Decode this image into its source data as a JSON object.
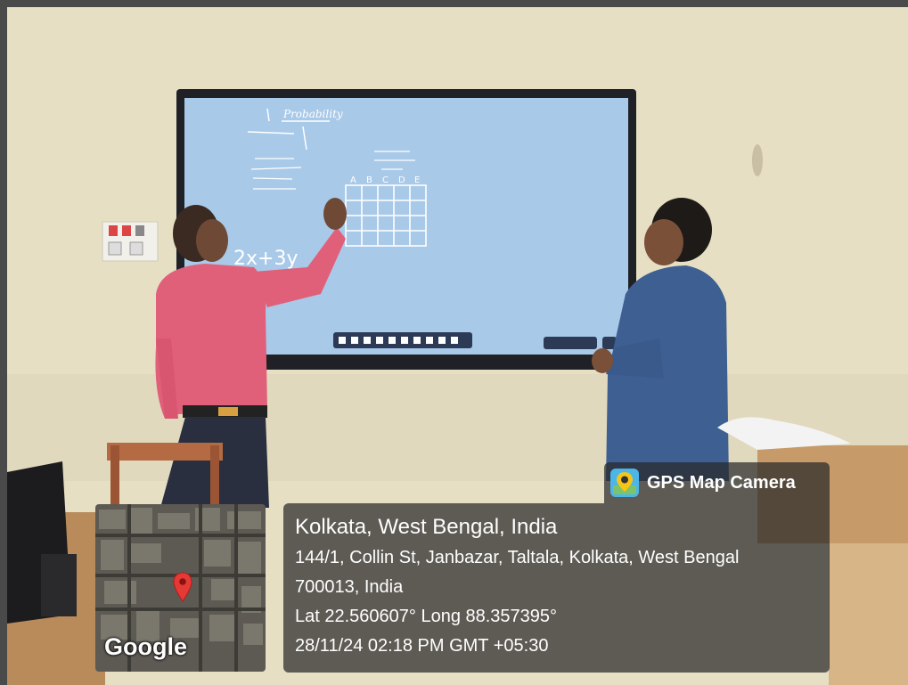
{
  "gps_badge": {
    "app_name": "GPS Map Camera",
    "icon": "map-pin-camera-icon"
  },
  "map": {
    "provider_label": "Google",
    "pin_color": "#e53935"
  },
  "location": {
    "title": "Kolkata, West Bengal, India",
    "address_line_1": "144/1, Collin St, Janbazar, Taltala, Kolkata, West Bengal",
    "address_line_2": "700013, India",
    "coordinates": "Lat 22.560607° Long 88.357395°",
    "datetime": "28/11/24 02:18 PM GMT +05:30"
  },
  "board": {
    "heading": "Probability",
    "equation": "2x+3y",
    "grid_columns": [
      "A",
      "B",
      "C",
      "D",
      "E"
    ]
  },
  "colors": {
    "wall": "#e8e1c6",
    "board_screen": "#a8c8e6",
    "shirt_pink": "#e0607a",
    "shirt_blue": "#3a5a8c",
    "overlay": "#282828"
  }
}
